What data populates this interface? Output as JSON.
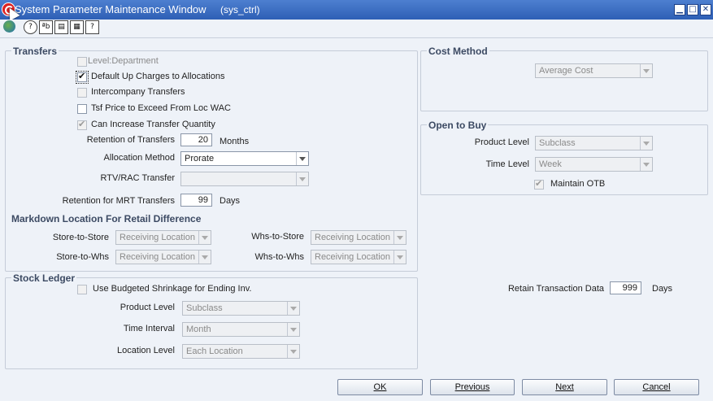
{
  "window": {
    "title": "System Parameter Maintenance Window",
    "subtitle": "(sys_ctrl)"
  },
  "toolbar": {
    "icons": [
      "globe-icon",
      "help-circle-icon",
      "spell-check-icon",
      "notes-icon",
      "calculator-icon",
      "question-icon"
    ],
    "glyphs": [
      "?",
      "ªb",
      "▤",
      "▦",
      "?"
    ]
  },
  "transfers": {
    "title": "Transfers",
    "level_department": "Level:Department",
    "default_up_charges": "Default Up Charges to Allocations",
    "intercompany": "Intercompany Transfers",
    "tsf_price": "Tsf Price to Exceed From Loc WAC",
    "can_increase": "Can Increase Transfer Quantity",
    "retention_label": "Retention of Transfers",
    "retention_value": "20",
    "retention_unit": "Months",
    "allocation_label": "Allocation Method",
    "allocation_value": "Prorate",
    "rtv_label": "RTV/RAC Transfer",
    "rtv_value": "",
    "mrt_label": "Retention for MRT Transfers",
    "mrt_value": "99",
    "mrt_unit": "Days"
  },
  "markdown": {
    "title": "Markdown Location For Retail Difference",
    "store_to_store": "Store-to-Store",
    "store_to_store_value": "Receiving Location",
    "whs_to_store": "Whs-to-Store",
    "whs_to_store_value": "Receiving Location",
    "store_to_whs": "Store-to-Whs",
    "store_to_whs_value": "Receiving Location",
    "whs_to_whs": "Whs-to-Whs",
    "whs_to_whs_value": "Receiving Location"
  },
  "stock_ledger": {
    "title": "Stock Ledger",
    "budgeted": "Use Budgeted Shrinkage for Ending Inv.",
    "product_label": "Product Level",
    "product_value": "Subclass",
    "time_label": "Time Interval",
    "time_value": "Month",
    "location_label": "Location Level",
    "location_value": "Each Location"
  },
  "cost_method": {
    "title": "Cost Method",
    "value": "Average Cost"
  },
  "otb": {
    "title": "Open to Buy",
    "product_label": "Product Level",
    "product_value": "Subclass",
    "time_label": "Time Level",
    "time_value": "Week",
    "maintain": "Maintain OTB"
  },
  "retain": {
    "label": "Retain Transaction Data",
    "value": "999",
    "unit": "Days"
  },
  "buttons": {
    "ok": "OK",
    "previous": "Previous",
    "next": "Next",
    "cancel": "Cancel"
  }
}
